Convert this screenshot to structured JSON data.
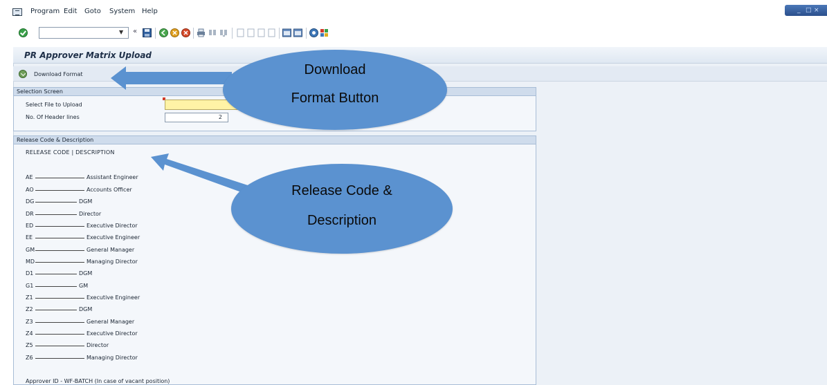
{
  "menubar": {
    "items": [
      "Program",
      "Edit",
      "Goto",
      "System",
      "Help"
    ]
  },
  "window_controls": [
    "_",
    "□",
    "×"
  ],
  "toolbar": {
    "icons": [
      "enter-icon",
      "back-icon",
      "save-icon",
      "back-nav-icon",
      "exit-icon",
      "cancel-icon",
      "print-icon",
      "find-icon",
      "find-next-icon",
      "first-page-icon",
      "prev-page-icon",
      "next-page-icon",
      "last-page-icon",
      "new-session-icon",
      "shortcut-icon",
      "help-icon",
      "layout-icon"
    ]
  },
  "page": {
    "title": "PR Approver Matrix Upload"
  },
  "app_toolbar": {
    "download_label": "Download Format"
  },
  "selection": {
    "title": "Selection Screen",
    "file_label": "Select File to Upload",
    "file_value": "",
    "header_label": "No. Of Header lines",
    "header_value": "2"
  },
  "release": {
    "title": "Release Code & Description",
    "header": "RELEASE CODE  |  DESCRIPTION",
    "rows": [
      {
        "code": "AE",
        "desc": "Assistant Engineer"
      },
      {
        "code": "AO",
        "desc": "Accounts Officer"
      },
      {
        "code": "DG",
        "desc": "DGM"
      },
      {
        "code": "DR",
        "desc": "Director"
      },
      {
        "code": "ED",
        "desc": "Executive Director"
      },
      {
        "code": "EE",
        "desc": "Executive Engineer"
      },
      {
        "code": "GM",
        "desc": "General Manager"
      },
      {
        "code": "MD",
        "desc": "Managing Director"
      },
      {
        "code": "D1",
        "desc": "DGM"
      },
      {
        "code": "G1",
        "desc": "GM"
      },
      {
        "code": "Z1",
        "desc": "Executive Engineer"
      },
      {
        "code": "Z2",
        "desc": "DGM"
      },
      {
        "code": "Z3",
        "desc": "General Manager"
      },
      {
        "code": "Z4",
        "desc": "Executive Director"
      },
      {
        "code": "Z5",
        "desc": "Director"
      },
      {
        "code": "Z6",
        "desc": "Managing Director"
      }
    ],
    "approver_note": "Approver ID - WF-BATCH (In case of vacant position)"
  },
  "callouts": {
    "download": {
      "line1": "Download",
      "line2": "Format Button"
    },
    "release": {
      "line1": "Release Code &",
      "line2": "Description"
    }
  },
  "colors": {
    "callout": "#5b92d0",
    "required_field": "#fff3a6",
    "panel": "#ecf1f7"
  }
}
